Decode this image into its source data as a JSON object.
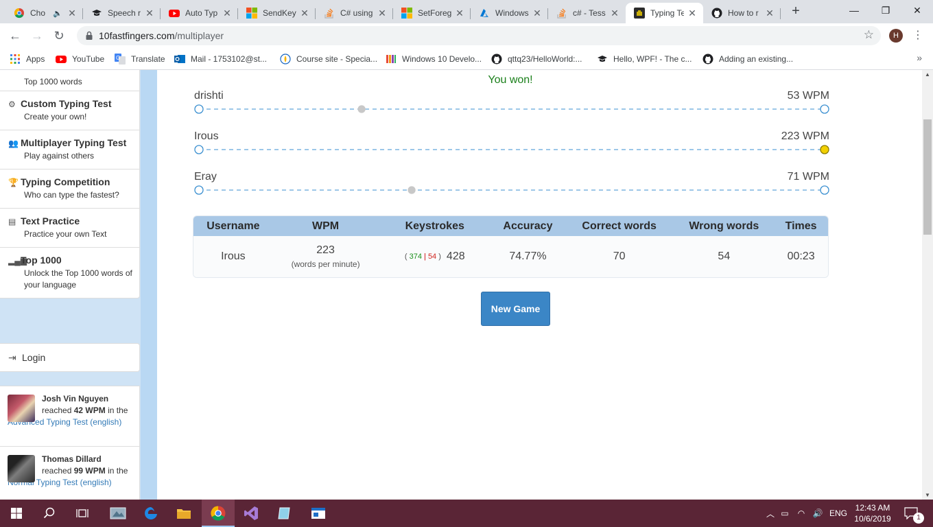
{
  "browser": {
    "tabs": [
      {
        "title": "Cho",
        "favicon": "chrome-icon",
        "color": "#1a73e8",
        "muted": true
      },
      {
        "title": "Speech r",
        "favicon": "mortarboard-icon",
        "color": "#202124"
      },
      {
        "title": "Auto Typ",
        "favicon": "youtube-icon",
        "color": "#ff0000"
      },
      {
        "title": "SendKeys",
        "favicon": "microsoft-icon",
        "color": "#f25022"
      },
      {
        "title": "C# using",
        "favicon": "stackoverflow-icon",
        "color": "#f48024"
      },
      {
        "title": "SetForeg",
        "favicon": "microsoft-icon",
        "color": "#f25022"
      },
      {
        "title": "Windows",
        "favicon": "azure-icon",
        "color": "#0078d4"
      },
      {
        "title": "c# - Tess",
        "favicon": "stackoverflow-icon",
        "color": "#f48024"
      },
      {
        "title": "Typing Te",
        "favicon": "tenfastfingers-icon",
        "color": "#2b2b2b",
        "active": true
      },
      {
        "title": "How to r",
        "favicon": "github-icon",
        "color": "#202124"
      }
    ],
    "new_tab": "+",
    "window_controls": {
      "minimize": "—",
      "restore": "❐",
      "close": "✕"
    },
    "url_host": "10fastfingers.com",
    "url_path": "/multiplayer",
    "profile_initial": "H",
    "bookmarks": [
      {
        "label": "Apps",
        "icon": "apps-grid-icon",
        "color": "#4285f4"
      },
      {
        "label": "YouTube",
        "icon": "youtube-icon",
        "color": "#ff0000"
      },
      {
        "label": "Translate",
        "icon": "translate-icon",
        "color": "#4285f4"
      },
      {
        "label": "Mail - 1753102@st...",
        "icon": "outlook-icon",
        "color": "#0072c6"
      },
      {
        "label": "Course site - Specia...",
        "icon": "course-icon",
        "color": "#1565c0"
      },
      {
        "label": "Windows 10 Develo...",
        "icon": "book-icon",
        "color": "#8e44ad"
      },
      {
        "label": "qttq23/HelloWorld:...",
        "icon": "github-icon",
        "color": "#202124"
      },
      {
        "label": "Hello, WPF! - The c...",
        "icon": "mortarboard-icon",
        "color": "#202124"
      },
      {
        "label": "Adding an existing...",
        "icon": "github-icon",
        "color": "#202124"
      }
    ],
    "bookmarks_more": "»"
  },
  "sidebar": {
    "nav": [
      {
        "title": "",
        "subtitle": "Top 1000 words",
        "icon": "chart-icon"
      },
      {
        "title": "Custom Typing Test",
        "subtitle": "Create your own!",
        "icon": "cogs-icon"
      },
      {
        "title": "Multiplayer Typing Test",
        "subtitle": "Play against others",
        "icon": "users-icon"
      },
      {
        "title": "Typing Competition",
        "subtitle": "Who can type the fastest?",
        "icon": "trophy-icon"
      },
      {
        "title": "Text Practice",
        "subtitle": "Practice your own Text",
        "icon": "document-icon"
      },
      {
        "title": "Top 1000",
        "subtitle": "Unlock the Top 1000 words of your language",
        "icon": "signal-icon"
      }
    ],
    "login_label": "Login",
    "feed": [
      {
        "name": "Josh Vin Nguyen",
        "reached": "reached",
        "wpm": "42 WPM",
        "in_the": "in the",
        "test": "Advanced Typing Test (english)"
      },
      {
        "name": "Thomas Dillard",
        "reached": "reached",
        "wpm": "99 WPM",
        "in_the": "in the",
        "test": "Normal Typing Test (english)"
      }
    ]
  },
  "race": {
    "status": "You won!",
    "racers": [
      {
        "name": "drishti",
        "wpm_label": "53 WPM",
        "progress": 0.26,
        "finished": false
      },
      {
        "name": "Irous",
        "wpm_label": "223 WPM",
        "progress": 1.0,
        "finished": true
      },
      {
        "name": "Eray",
        "wpm_label": "71 WPM",
        "progress": 0.34,
        "finished": false
      }
    ],
    "colors": {
      "track": "#3a8fd0",
      "marker": "#c8c8c8",
      "winner": "#f2d000"
    }
  },
  "results": {
    "headers": {
      "username": "Username",
      "wpm": "WPM",
      "keystrokes": "Keystrokes",
      "accuracy": "Accuracy",
      "correct": "Correct words",
      "wrong": "Wrong words",
      "time": "Times"
    },
    "row": {
      "username": "Irous",
      "wpm": "223",
      "wpm_unit": "(words per minute)",
      "ks_open": "(",
      "ks_correct": "374",
      "ks_sep": "|",
      "ks_wrong": "54",
      "ks_close": ")",
      "ks_total": "428",
      "accuracy": "74.77%",
      "correct_words": "70",
      "wrong_words": "54",
      "time": "00:23"
    }
  },
  "new_game_label": "New Game",
  "taskbar": {
    "apps": [
      {
        "icon": "windows-start-icon"
      },
      {
        "icon": "search-icon"
      },
      {
        "icon": "task-view-icon"
      },
      {
        "icon": "snipping-tool-icon"
      },
      {
        "icon": "edge-icon"
      },
      {
        "icon": "file-explorer-icon"
      },
      {
        "icon": "chrome-icon",
        "active": true
      },
      {
        "icon": "visual-studio-icon"
      },
      {
        "icon": "app-icon"
      },
      {
        "icon": "window-app-icon"
      }
    ],
    "language": "ENG",
    "time": "12:43 AM",
    "date": "10/6/2019",
    "notification_count": "1"
  }
}
